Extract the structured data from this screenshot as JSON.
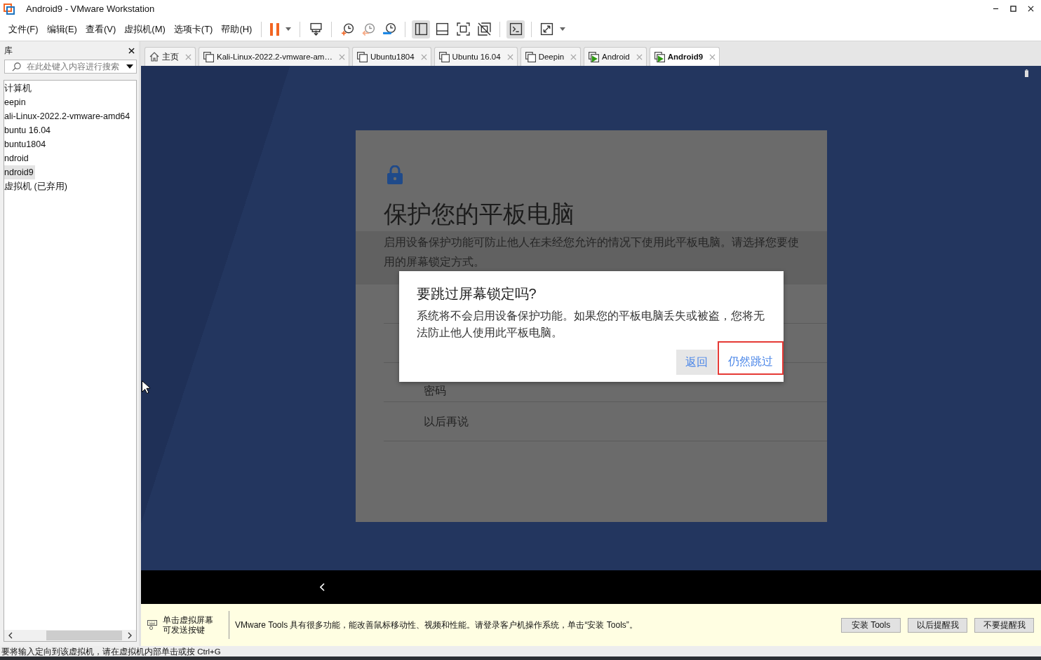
{
  "window": {
    "title": "Android9 - VMware Workstation"
  },
  "menu": [
    "文件(F)",
    "编辑(E)",
    "查看(V)",
    "虚拟机(M)",
    "选项卡(T)",
    "帮助(H)"
  ],
  "toolbar": [
    [
      {
        "kind": "pause",
        "pressed": false,
        "disabled": false,
        "dropdown": true
      }
    ],
    [
      {
        "kind": "send-keys",
        "pressed": false,
        "disabled": false
      }
    ],
    [
      {
        "kind": "snapshot",
        "pressed": false,
        "disabled": false
      },
      {
        "kind": "revert",
        "pressed": false,
        "disabled": true
      },
      {
        "kind": "snapshot-manager",
        "pressed": false,
        "disabled": false
      }
    ],
    [
      {
        "kind": "library-view",
        "pressed": true,
        "disabled": false
      },
      {
        "kind": "thumbnail-view",
        "pressed": false,
        "disabled": false
      },
      {
        "kind": "full-screen",
        "pressed": false,
        "disabled": false
      },
      {
        "kind": "unity",
        "pressed": false,
        "disabled": false
      }
    ],
    [
      {
        "kind": "console-view",
        "pressed": true,
        "disabled": false
      }
    ],
    [
      {
        "kind": "stretch",
        "pressed": false,
        "disabled": false,
        "dropdown": true
      }
    ]
  ],
  "library": {
    "title": "库",
    "search": {
      "placeholder": "在此处键入内容进行搜索"
    },
    "items": [
      {
        "label": "计算机",
        "selected": false
      },
      {
        "label": "eepin",
        "selected": false
      },
      {
        "label": "ali-Linux-2022.2-vmware-amd64",
        "selected": false
      },
      {
        "label": "buntu 16.04",
        "selected": false
      },
      {
        "label": "buntu1804",
        "selected": false
      },
      {
        "label": "ndroid",
        "selected": false
      },
      {
        "label": "ndroid9",
        "selected": true
      },
      {
        "label": "虚拟机 (已弃用)",
        "selected": false
      }
    ]
  },
  "tabs": [
    {
      "label": "主页",
      "kind": "home",
      "running": false,
      "selected": false
    },
    {
      "label": "Kali-Linux-2022.2-vmware-am…",
      "kind": "vm",
      "running": false,
      "selected": false
    },
    {
      "label": "Ubuntu1804",
      "kind": "vm",
      "running": false,
      "selected": false
    },
    {
      "label": "Ubuntu 16.04",
      "kind": "vm",
      "running": false,
      "selected": false
    },
    {
      "label": "Deepin",
      "kind": "vm",
      "running": false,
      "selected": false
    },
    {
      "label": "Android",
      "kind": "vm",
      "running": true,
      "selected": false
    },
    {
      "label": "Android9",
      "kind": "vm",
      "running": true,
      "selected": true
    }
  ],
  "guest": {
    "lock_screen": {
      "title": "保护您的平板电脑",
      "description": "启用设备保护功能可防止他人在未经您允许的情况下使用此平板电脑。请选择您要使用的屏幕锁定方式。",
      "options": [
        "密码",
        "以后再说"
      ]
    },
    "dialog": {
      "title": "要跳过屏幕锁定吗?",
      "message": "系统将不会启用设备保护功能。如果您的平板电脑丢失或被盗，您将无法防止他人使用此平板电脑。",
      "buttons": [
        {
          "label": "返回",
          "focused": true,
          "highlighted": false
        },
        {
          "label": "仍然跳过",
          "focused": false,
          "highlighted": true
        }
      ]
    }
  },
  "tools_bar": {
    "hint": "单击虚拟屏幕可发送按键",
    "message": "VMware Tools 具有很多功能，能改善鼠标移动性、视频和性能。请登录客户机操作系统，单击“安装 Tools”。",
    "buttons": [
      "安装 Tools",
      "以后提醒我",
      "不要提醒我"
    ]
  },
  "status_bar": "要将输入定向到该虚拟机，请在虚拟机内部单击或按 Ctrl+G"
}
